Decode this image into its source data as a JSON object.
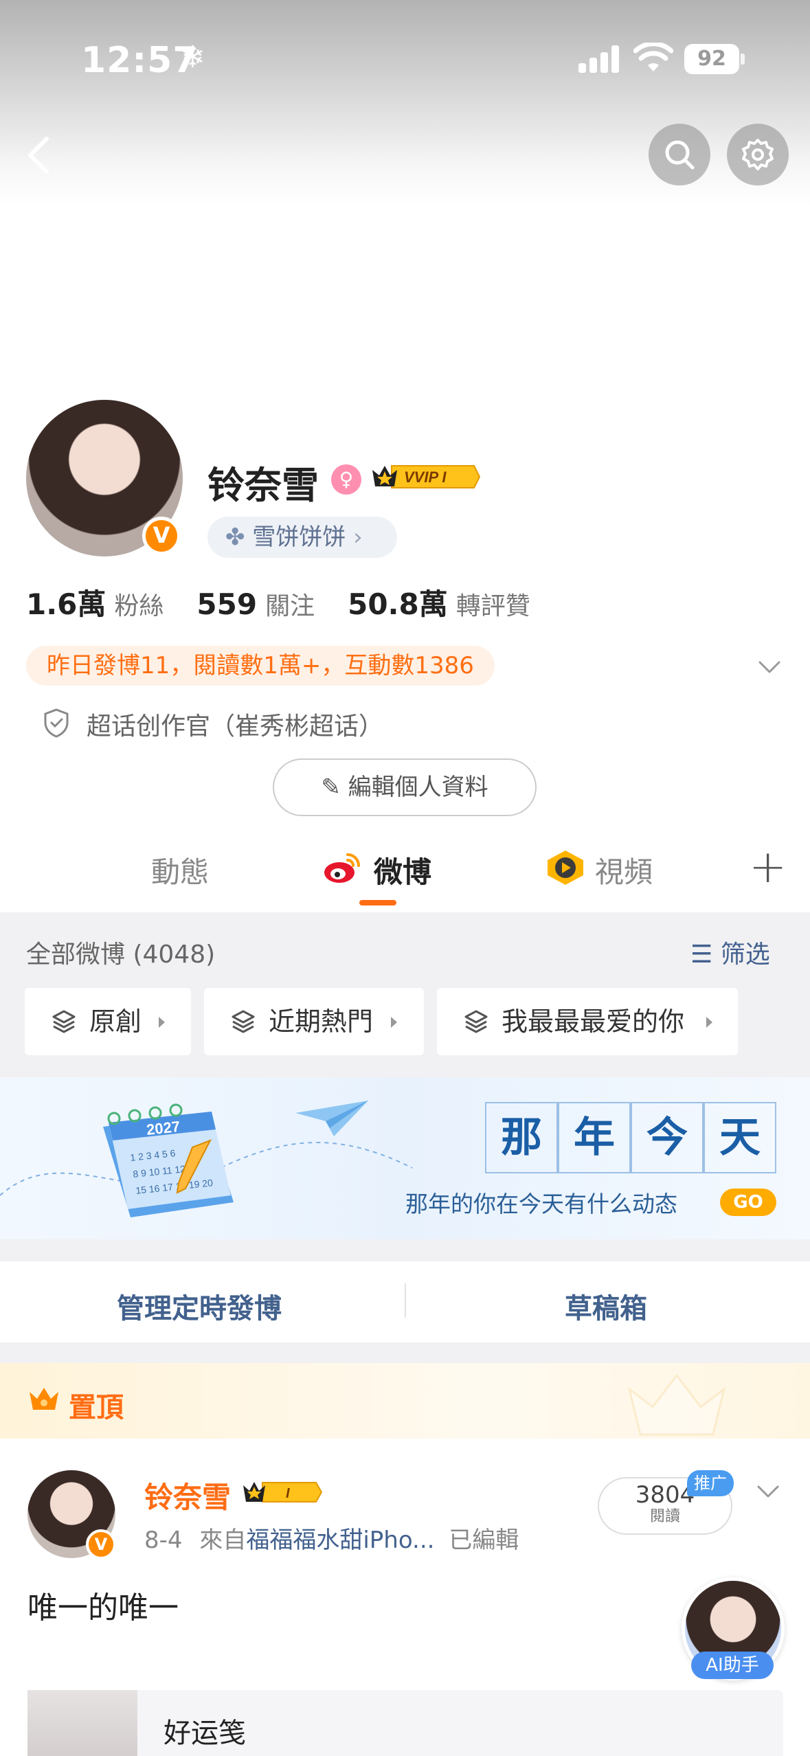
{
  "status": {
    "time": "12:57",
    "snow": "❄",
    "battery": "92"
  },
  "profile": {
    "name": "铃奈雪",
    "vvip": "VVIP I",
    "fan_group": "雪饼饼饼",
    "v_badge": "V",
    "gender": "♀",
    "stats": [
      {
        "value": "1.6萬",
        "label": "粉絲"
      },
      {
        "value": "559",
        "label": "關注"
      },
      {
        "value": "50.8萬",
        "label": "轉評贊"
      }
    ],
    "activity": "昨日發博11，閱讀數1萬+，互動數1386",
    "super_title": "超话创作官（崔秀彬超话）",
    "edit_button": "編輯個人資料"
  },
  "tabs": [
    {
      "label": "動態"
    },
    {
      "label": "微博"
    },
    {
      "label": "視頻"
    }
  ],
  "plus": "+",
  "feed": {
    "all_label": "全部微博 (4048)",
    "filter_label": "筛选",
    "chips": [
      "原創",
      "近期熱門",
      "我最最最爱的你"
    ]
  },
  "banner": {
    "title_chars": [
      "那",
      "年",
      "今",
      "天"
    ],
    "subtitle": "那年的你在今天有什么动态",
    "go": "GO",
    "calendar_year": "2027"
  },
  "manage": {
    "scheduled": "管理定時發博",
    "drafts": "草稿箱"
  },
  "pinned": {
    "label": "置頂"
  },
  "post": {
    "author": "铃奈雪",
    "badge": "I",
    "date": "8-4",
    "from_prefix": "來自",
    "source": "福福福水甜iPho...",
    "edited": "已編輯",
    "reads": "3804",
    "reads_label": "閱讀",
    "promo": "推广",
    "v_badge": "V",
    "text": "唯一的唯一",
    "card_title": "好运笺"
  },
  "ai": {
    "label": "AI助手"
  },
  "colors": {
    "accent": "#ff6c13",
    "link": "#43618f",
    "vip_gold": "#ffc21a"
  }
}
